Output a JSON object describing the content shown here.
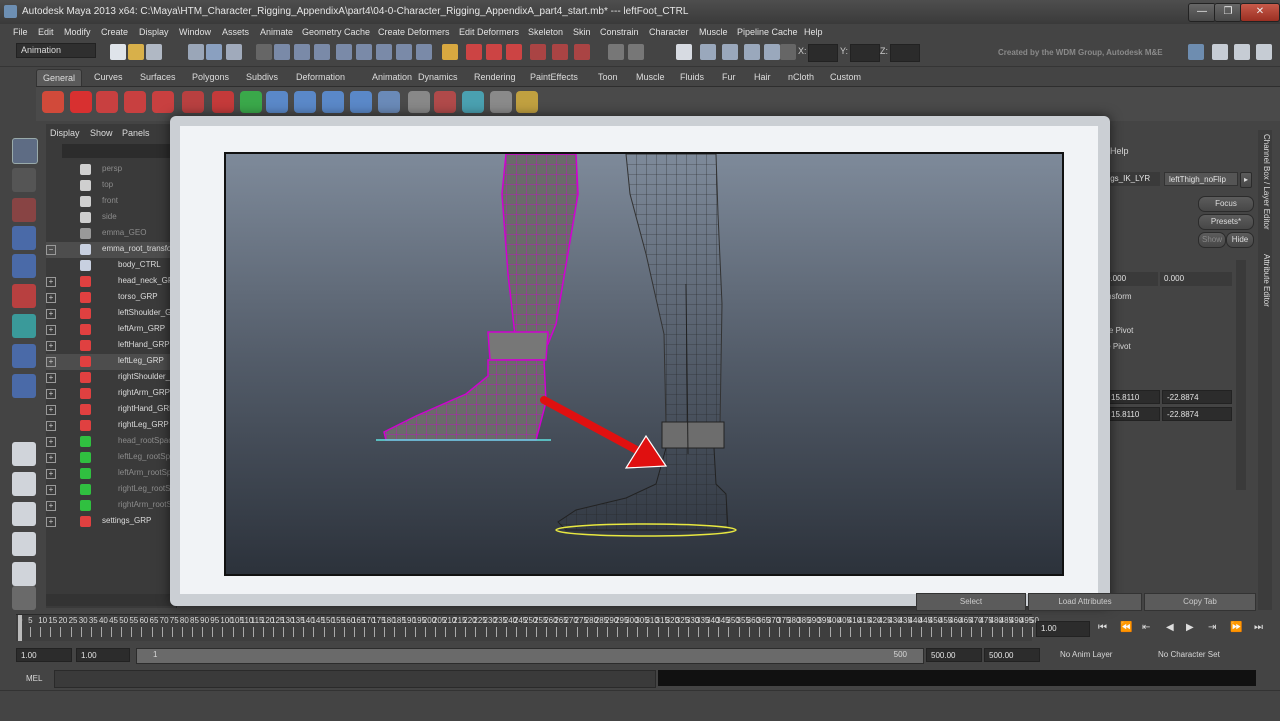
{
  "window": {
    "title": "Autodesk Maya 2013 x64: C:\\Maya\\HTM_Character_Rigging_AppendixA\\part4\\04-0-Character_Rigging_AppendixA_part4_start.mb*   ---   leftFoot_CTRL",
    "minimize": "—",
    "maximize": "❐",
    "close": "✕"
  },
  "menu": [
    "File",
    "Edit",
    "Modify",
    "Create",
    "Display",
    "Window",
    "Assets",
    "Animate",
    "Geometry Cache",
    "Create Deformers",
    "Edit Deformers",
    "Skeleton",
    "Skin",
    "Constrain",
    "Character",
    "Muscle",
    "Pipeline Cache",
    "Help"
  ],
  "status": {
    "mode": "Animation",
    "x_label": "X:",
    "y_label": "Y:",
    "z_label": "Z:",
    "credit": "Created by the WDM Group, Autodesk M&E"
  },
  "shelf_tabs": [
    "General",
    "Curves",
    "Surfaces",
    "Polygons",
    "Subdivs",
    "Deformation",
    "Animation",
    "Dynamics",
    "Rendering",
    "PaintEffects",
    "Toon",
    "Muscle",
    "Fluids",
    "Fur",
    "Hair",
    "nCloth",
    "Custom"
  ],
  "outliner": {
    "menu": [
      "Display",
      "Show",
      "Panels"
    ],
    "rows": [
      {
        "label": "persp",
        "dim": true
      },
      {
        "label": "top",
        "dim": true
      },
      {
        "label": "front",
        "dim": true
      },
      {
        "label": "side",
        "dim": true
      },
      {
        "label": "emma_GEO",
        "dim": true
      },
      {
        "label": "emma_root_transform",
        "dim": false
      },
      {
        "label": "body_CTRL",
        "dim": false
      },
      {
        "label": "head_neck_GRP",
        "dim": false
      },
      {
        "label": "torso_GRP",
        "dim": false
      },
      {
        "label": "leftShoulder_GRP",
        "dim": false
      },
      {
        "label": "leftArm_GRP",
        "dim": false
      },
      {
        "label": "leftHand_GRP",
        "dim": false
      },
      {
        "label": "leftLeg_GRP",
        "dim": false
      },
      {
        "label": "rightShoulder_GRP",
        "dim": false
      },
      {
        "label": "rightArm_GRP",
        "dim": false
      },
      {
        "label": "rightHand_GRP",
        "dim": false
      },
      {
        "label": "rightLeg_GRP",
        "dim": false
      },
      {
        "label": "head_rootSpace",
        "dim": true
      },
      {
        "label": "leftLeg_rootSpace",
        "dim": true
      },
      {
        "label": "leftArm_rootSpace",
        "dim": true
      },
      {
        "label": "rightLeg_rootSpace",
        "dim": true
      },
      {
        "label": "rightArm_rootSpace",
        "dim": true
      },
      {
        "label": "settings_GRP",
        "dim": false
      }
    ]
  },
  "channel": {
    "help": "Help",
    "layer_tabs": [
      "legs_IK_LYR",
      "leftThigh_noFlip"
    ],
    "focus": "Focus",
    "presets": "Presets*",
    "show": "Show",
    "hide": "Hide",
    "row1": [
      "0.000",
      "0.000"
    ],
    "transform": "ransform",
    "rotate_pivot": "tate Pivot",
    "scale_pivot": "ale Pivot",
    "row2": [
      "15.8110",
      "-22.8874"
    ],
    "row3": [
      "15.8110",
      "-22.8874"
    ],
    "side_tabs": [
      "Channel Box / Layer Editor",
      "Attribute Editor"
    ]
  },
  "bottom": {
    "select": "Select",
    "load_attributes": "Load Attributes",
    "copy_tab": "Copy Tab",
    "ticks": [
      "0",
      "5",
      "10",
      "15",
      "20",
      "25",
      "30",
      "35",
      "40",
      "45",
      "50",
      "55",
      "60",
      "65",
      "70",
      "75",
      "80",
      "85",
      "90",
      "95",
      "100",
      "105",
      "110",
      "115",
      "120",
      "125",
      "130",
      "135",
      "140",
      "145",
      "150",
      "155",
      "160",
      "165",
      "170",
      "175",
      "180",
      "185",
      "190",
      "195",
      "200",
      "205",
      "210",
      "215",
      "220",
      "225",
      "230",
      "235",
      "240",
      "245",
      "250",
      "255",
      "260",
      "265",
      "270",
      "275",
      "280",
      "285",
      "290",
      "295",
      "300",
      "305",
      "310",
      "315",
      "320",
      "325",
      "330",
      "335",
      "340",
      "345",
      "350",
      "355",
      "360",
      "365",
      "370",
      "375",
      "380",
      "385",
      "390",
      "395",
      "400",
      "405",
      "410",
      "415",
      "420",
      "425",
      "430",
      "435",
      "440",
      "445",
      "450",
      "455",
      "460",
      "465",
      "470",
      "475",
      "480",
      "485",
      "490",
      "495",
      "50"
    ],
    "current_frame": "1.00",
    "range_start": "1.00",
    "range_inner_start": "1.00",
    "range_thumb": "1",
    "range_thumb_end": "500",
    "range_end_a": "500.00",
    "range_end_b": "500.00",
    "anim_layer": "No Anim Layer",
    "char_set": "No Character Set",
    "mel": "MEL"
  },
  "colors": {
    "accent_magenta": "#d000d0",
    "arrow_red": "#e01010",
    "select_yellow": "#e8e840",
    "ground_cyan": "#60e0e0"
  }
}
